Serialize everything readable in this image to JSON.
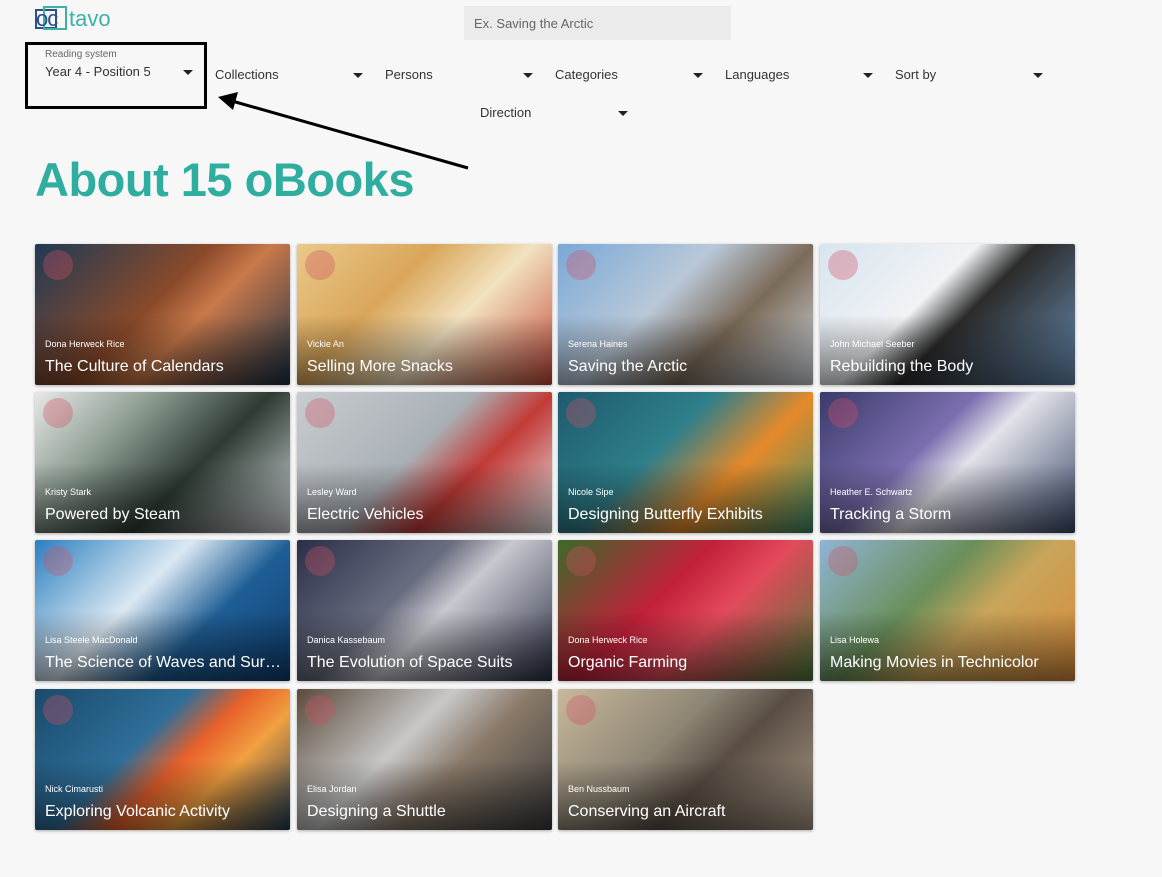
{
  "brand": {
    "logo_mark": "oc",
    "logo_text": "tavo"
  },
  "search": {
    "placeholder": "Ex. Saving the Arctic"
  },
  "filters": [
    {
      "label": "Reading system",
      "value": "Year 4 - Position 5"
    },
    {
      "label": "",
      "value": "Collections"
    },
    {
      "label": "",
      "value": "Persons"
    },
    {
      "label": "",
      "value": "Categories"
    },
    {
      "label": "",
      "value": "Languages"
    },
    {
      "label": "",
      "value": "Sort by"
    },
    {
      "label": "",
      "value": "Direction"
    }
  ],
  "heading": "About 15 oBooks",
  "colors": {
    "accent": "#2fae9f",
    "logo_blue": "#2c4f8a"
  },
  "books": [
    {
      "author": "Dona Herweck Rice",
      "title": "The Culture of Calendars",
      "bg": "linear-gradient(135deg,#1f3a55 0%,#8a4a2a 45%,#c9794a 60%,#1c3146 100%)"
    },
    {
      "author": "Vickie An",
      "title": "Selling More Snacks",
      "bg": "linear-gradient(135deg,#e9c98a 0%,#d9a65a 35%,#f2e2c0 60%,#c44b3a 100%)"
    },
    {
      "author": "Serena Haines",
      "title": "Saving the Arctic",
      "bg": "linear-gradient(135deg,#7aa8d8 0%,#b9c8d8 40%,#7b6a58 65%,#d5dde6 100%)"
    },
    {
      "author": "John Michael Seeber",
      "title": "Rebuilding the Body",
      "bg": "linear-gradient(135deg,#d7e4ef 0%,#f1f3f5 40%,#2b2b2b 55%,#6a8fb5 100%)"
    },
    {
      "author": "Kristy Stark",
      "title": "Powered by Steam",
      "bg": "linear-gradient(135deg,#e8e8e8 0%,#8e9e92 30%,#2d3b33 60%,#d8dde0 100%)"
    },
    {
      "author": "Lesley Ward",
      "title": "Electric Vehicles",
      "bg": "linear-gradient(135deg,#c8ccd0 0%,#a9b0b5 45%,#c23a36 65%,#e8eaec 100%)"
    },
    {
      "author": "Nicole Sipe",
      "title": "Designing Butterfly Exhibits",
      "bg": "linear-gradient(135deg,#1e5b6e 0%,#2f7f8a 40%,#e58a2a 65%,#3e8f6b 100%)"
    },
    {
      "author": "Heather E. Schwartz",
      "title": "Tracking a Storm",
      "bg": "linear-gradient(135deg,#3a3a6a 0%,#7c6fb0 40%,#e2e2ea 55%,#3b4a6a 100%)"
    },
    {
      "author": "Lisa Steele MacDonald",
      "title": "The Science of Waves and Surfing",
      "bg": "linear-gradient(135deg,#2a7fc0 0%,#dbe8f2 40%,#1f5e95 65%,#0f3e70 100%)"
    },
    {
      "author": "Danica Kassebaum",
      "title": "The Evolution of Space Suits",
      "bg": "linear-gradient(135deg,#2a2f4a 0%,#6a6e80 40%,#c7c9cf 55%,#2b2f45 100%)"
    },
    {
      "author": "Dona Herweck Rice",
      "title": "Organic Farming",
      "bg": "linear-gradient(135deg,#3b6a2a 0%,#c2203a 40%,#e24a5a 60%,#4a7a3a 100%)"
    },
    {
      "author": "Lisa Holewa",
      "title": "Making Movies in Technicolor",
      "bg": "linear-gradient(135deg,#8fb4d6 0%,#6a8f5a 40%,#c9a55a 60%,#d58a3a 100%)"
    },
    {
      "author": "Nick Cimarusti",
      "title": "Exploring Volcanic Activity",
      "bg": "linear-gradient(135deg,#1a4a6a 0%,#2f6f9a 40%,#e8602a 55%,#f0a040 70%,#1f3c55 100%)"
    },
    {
      "author": "Elisa Jordan",
      "title": "Designing a Shuttle",
      "bg": "linear-gradient(135deg,#5a4a3a 0%,#c8c8c8 40%,#8a7a6a 60%,#3a3a3a 100%)"
    },
    {
      "author": "Ben Nussbaum",
      "title": "Conserving an Aircraft",
      "bg": "linear-gradient(135deg,#c9b89a 0%,#8e8676 40%,#5a4e44 60%,#a99a88 100%)"
    }
  ]
}
